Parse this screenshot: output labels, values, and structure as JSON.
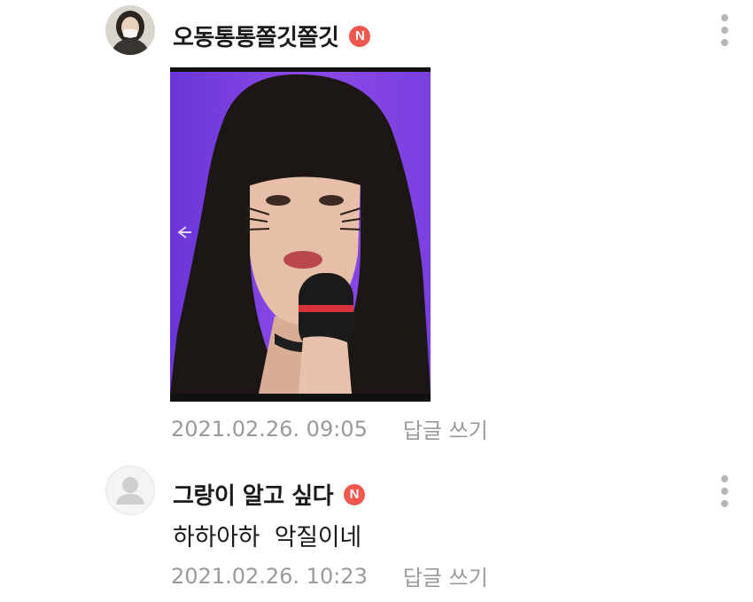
{
  "comments": [
    {
      "username": "오동통통쫄깃쫄깃",
      "badge": "N",
      "timestamp": "2021.02.26. 09:05",
      "reply_label": "답글 쓰기",
      "avatar_icon": "user-photo-avatar",
      "attachment_icon": "photo-attachment"
    },
    {
      "username": "그랑이 알고 싶다",
      "badge": "N",
      "text": "하하아하  악질이네",
      "timestamp": "2021.02.26. 10:23",
      "reply_label": "답글 쓰기",
      "avatar_icon": "default-user-avatar"
    }
  ],
  "colors": {
    "badge": "#f0584f",
    "meta_text": "#9a9a9a",
    "primary_text": "#1a1a1a"
  }
}
